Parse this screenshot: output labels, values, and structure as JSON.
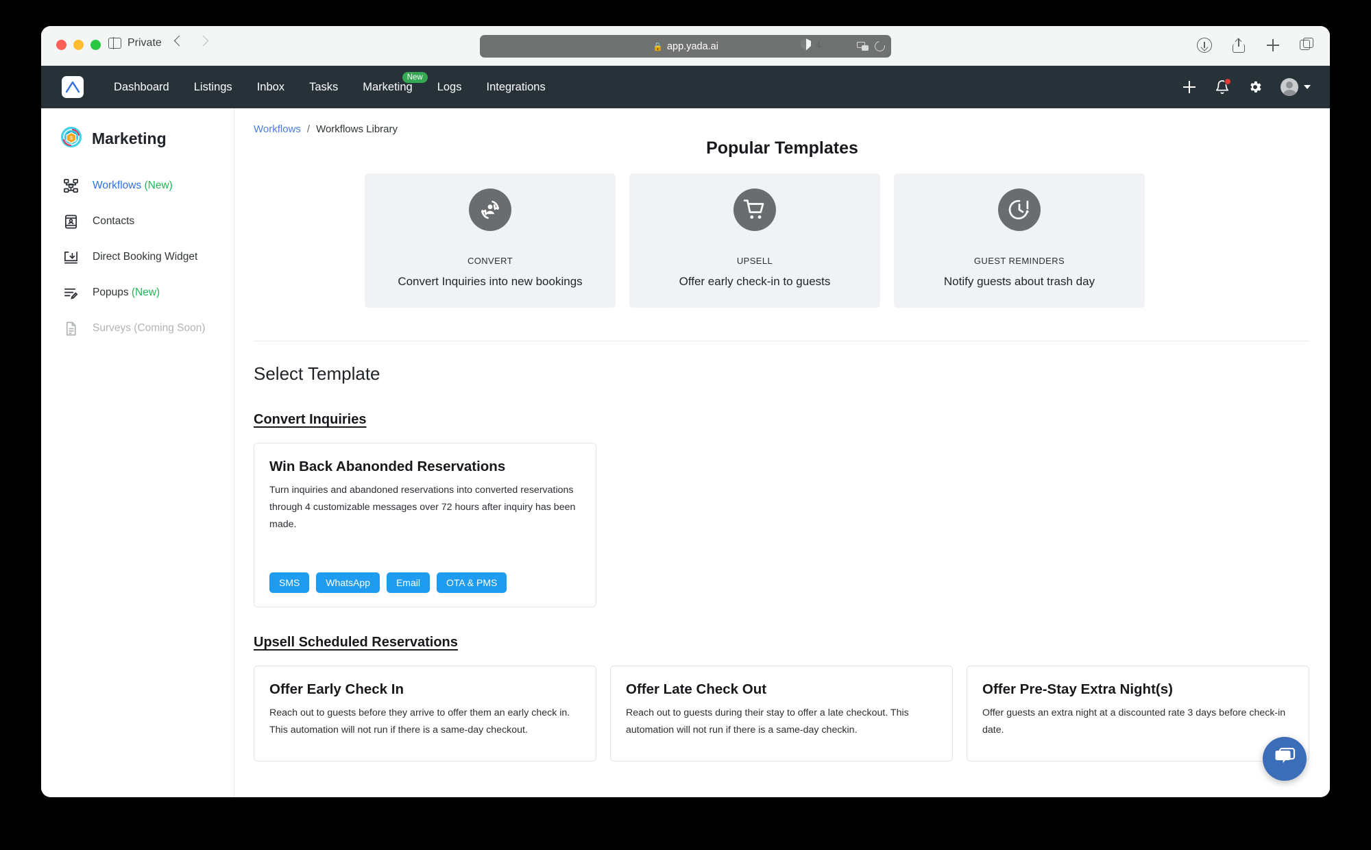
{
  "browser": {
    "profile_label": "Private",
    "url": "app.yada.ai",
    "lock_glyph": "ὑ2",
    "tracker_count": "4",
    "icons": {
      "back": "chevron-left-icon",
      "forward": "chevron-right-icon",
      "translate": "translate-icon",
      "reload": "reload-icon",
      "shield": "shield-icon",
      "download": "download-icon",
      "share": "share-icon",
      "new_tab": "plus-icon",
      "tabs": "tab-overview-icon"
    }
  },
  "appnav": {
    "items": [
      {
        "label": "Dashboard",
        "badge": ""
      },
      {
        "label": "Listings",
        "badge": ""
      },
      {
        "label": "Inbox",
        "badge": ""
      },
      {
        "label": "Tasks",
        "badge": ""
      },
      {
        "label": "Marketing",
        "badge": "New"
      },
      {
        "label": "Logs",
        "badge": ""
      },
      {
        "label": "Integrations",
        "badge": ""
      }
    ]
  },
  "sidebar": {
    "title": "Marketing",
    "items": [
      {
        "label": "Workflows ",
        "suffix": "(New)",
        "state": "active",
        "icon": "workflow-icon"
      },
      {
        "label": "Contacts",
        "suffix": "",
        "state": "",
        "icon": "contacts-icon"
      },
      {
        "label": "Direct Booking Widget",
        "suffix": "",
        "state": "",
        "icon": "direct-booking-icon"
      },
      {
        "label": "Popups ",
        "suffix": "(New)",
        "state": "",
        "icon": "popups-icon"
      },
      {
        "label": "Surveys (Coming Soon)",
        "suffix": "",
        "state": "disabled",
        "icon": "surveys-icon"
      }
    ]
  },
  "breadcrumb": {
    "root": "Workflows",
    "separator": "/",
    "current": "Workflows Library"
  },
  "popular": {
    "title": "Popular Templates",
    "cards": [
      {
        "kicker": "CONVERT",
        "subtitle": "Convert Inquiries into new bookings",
        "icon": "person-refresh-icon"
      },
      {
        "kicker": "UPSELL",
        "subtitle": "Offer early check-in to guests",
        "icon": "shopping-cart-icon"
      },
      {
        "kicker": "GUEST REMINDERS",
        "subtitle": "Notify guests about trash day",
        "icon": "clock-alert-icon"
      }
    ]
  },
  "select_template": {
    "heading": "Select Template",
    "groups": [
      {
        "name": "Convert Inquiries",
        "cards": [
          {
            "title": "Win Back Abanonded Reservations",
            "description": "Turn inquiries and abandoned reservations into converted reservations through 4 customizable messages over 72 hours after inquiry has been made.",
            "chips": [
              "SMS",
              "WhatsApp",
              "Email",
              "OTA & PMS"
            ]
          }
        ]
      },
      {
        "name": "Upsell Scheduled Reservations",
        "cards": [
          {
            "title": "Offer Early Check In",
            "description": "Reach out to guests before they arrive to offer them an early check in. This automation will not run if there is a same-day checkout.",
            "chips": []
          },
          {
            "title": "Offer Late Check Out",
            "description": "Reach out to guests during their stay to offer a late checkout. This automation will not run if there is a same-day checkin.",
            "chips": []
          },
          {
            "title": "Offer Pre-Stay Extra Night(s)",
            "description": "Offer guests an extra night at a discounted rate 3 days before check-in date.",
            "chips": []
          }
        ]
      }
    ]
  },
  "chat": {
    "icon": "chat-bubble-icon"
  },
  "colors": {
    "navbar": "#263238",
    "accent_blue": "#1f9bf0",
    "link_blue": "#2f6fe4",
    "new_green": "#1db954",
    "card_bg": "#f1f2f6",
    "icon_circle": "#6a6d6f",
    "chat_blue": "#3b6db8"
  }
}
